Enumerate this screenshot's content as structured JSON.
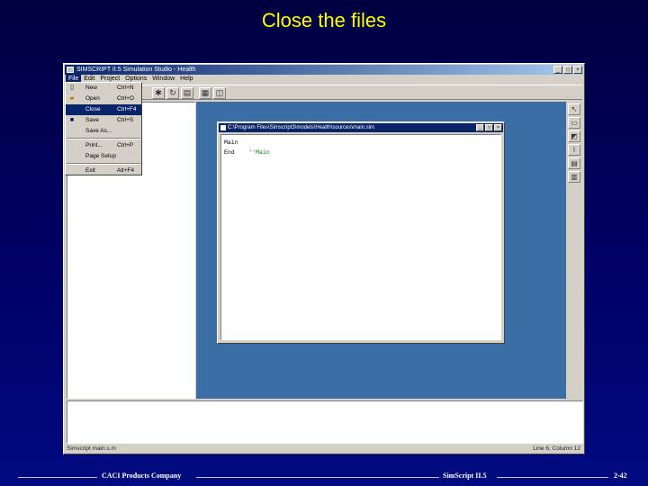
{
  "slide": {
    "title": "Close the files",
    "footer_left": "CACI Products Company",
    "footer_center": "SimScript II.5",
    "footer_right": "2-42"
  },
  "app": {
    "title": "SIMSCRIPT II.5 Simulation Studio - Health",
    "window_buttons": [
      "_",
      "□",
      "×"
    ],
    "menu": [
      "File",
      "Edit",
      "Project",
      "Options",
      "Window",
      "Help"
    ],
    "status_left": "Simscript main.s.m",
    "status_right": "Line 6, Column 12"
  },
  "file_menu": {
    "items": [
      {
        "label": "New",
        "shortcut": "Ctrl+N",
        "icon": "new-file-icon"
      },
      {
        "label": "Open",
        "shortcut": "Ctrl+O",
        "icon": "open-folder-icon"
      },
      {
        "label": "Close",
        "shortcut": "Ctrl+F4",
        "icon": ""
      },
      {
        "label": "Save",
        "shortcut": "Ctrl+S",
        "icon": "save-icon"
      },
      {
        "label": "Save As...",
        "shortcut": "",
        "icon": ""
      },
      {
        "label": "Print...",
        "shortcut": "Ctrl+P",
        "icon": ""
      },
      {
        "label": "Page Setup",
        "shortcut": "",
        "icon": ""
      },
      {
        "label": "Exit",
        "shortcut": "Alt+F4",
        "icon": ""
      }
    ],
    "selected": "Close"
  },
  "editor": {
    "title": "C:\\Program Files\\Simscript3\\models\\Health\\sources\\main.sim",
    "line1": "Main",
    "line2_code": "End",
    "line2_comment": "''Main"
  }
}
